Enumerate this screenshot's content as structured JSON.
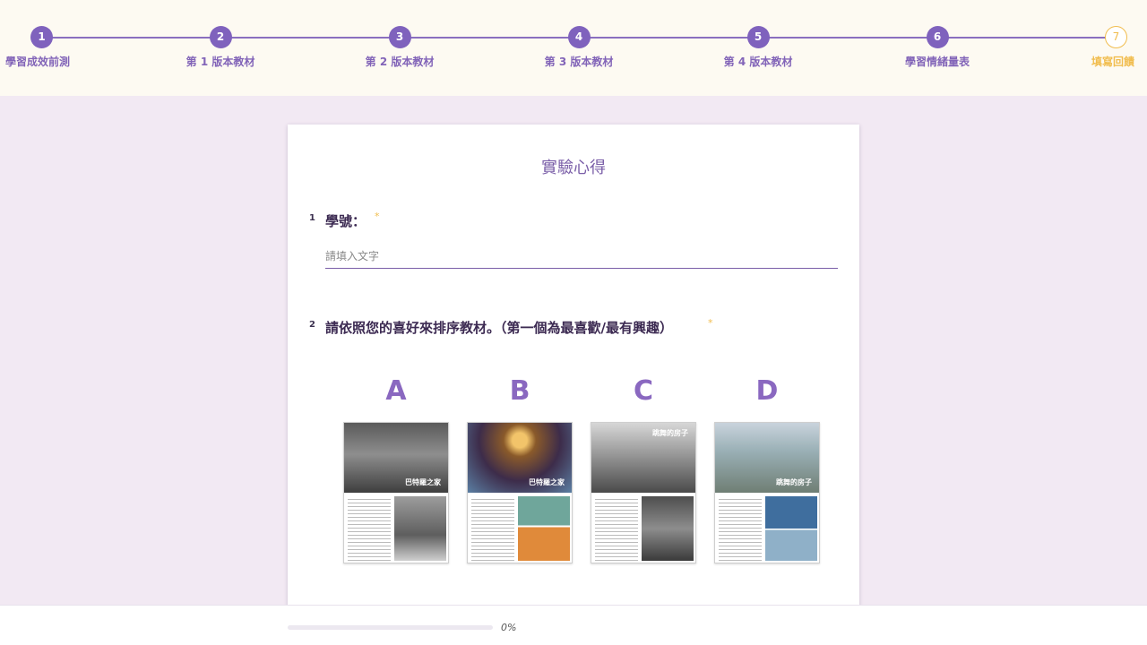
{
  "stepper": {
    "steps": [
      {
        "num": "1",
        "label": "學習成效前測"
      },
      {
        "num": "2",
        "label": "第 1 版本教材"
      },
      {
        "num": "3",
        "label": "第 2 版本教材"
      },
      {
        "num": "4",
        "label": "第 3 版本教材"
      },
      {
        "num": "5",
        "label": "第 4 版本教材"
      },
      {
        "num": "6",
        "label": "學習情緒量表"
      },
      {
        "num": "7",
        "label": "填寫回饋"
      }
    ],
    "current_step": 7
  },
  "form": {
    "title": "實驗心得",
    "q1": {
      "num": "1",
      "label": "學號：",
      "required_mark": "*",
      "placeholder": "請填入文字",
      "value": ""
    },
    "q2": {
      "num": "2",
      "label": "請依照您的喜好來排序教材。（第一個為最喜歡/最有興趣）",
      "required_mark": "*"
    },
    "materials": [
      {
        "letter": "A",
        "caption": "巴特羅之家"
      },
      {
        "letter": "B",
        "caption": "巴特羅之家"
      },
      {
        "letter": "C",
        "caption": "跳舞的房子"
      },
      {
        "letter": "D",
        "caption": "跳舞的房子"
      }
    ]
  },
  "progress": {
    "percent": 0,
    "label": "0%"
  },
  "colors": {
    "accent": "#7f62bd",
    "current": "#f1bd4f",
    "background": "#f2e9f3",
    "header_bg": "#fdfaf2"
  }
}
